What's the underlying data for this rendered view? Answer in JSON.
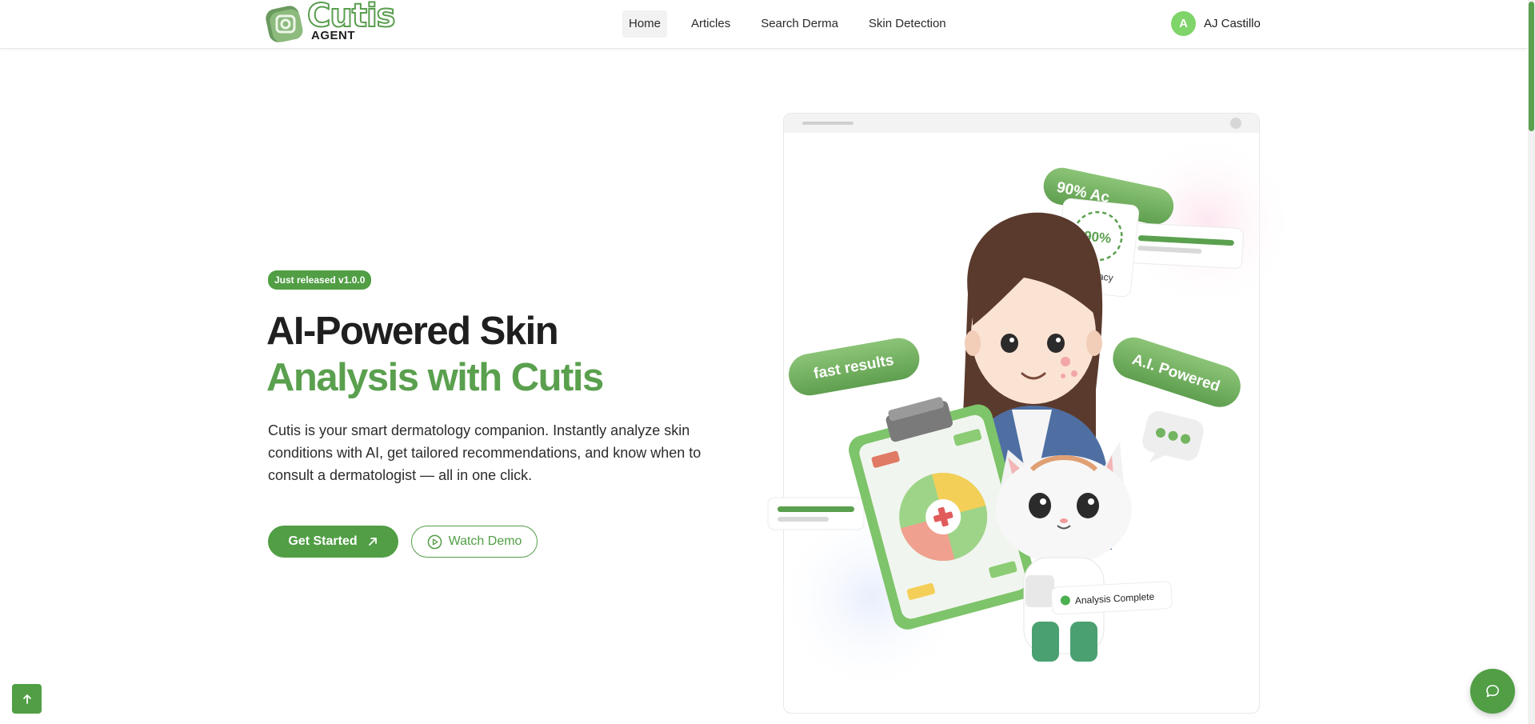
{
  "brand": {
    "name": "Cutis",
    "subtitle": "AGENT",
    "color": "#519e45"
  },
  "nav": {
    "items": [
      {
        "label": "Home",
        "active": true
      },
      {
        "label": "Articles",
        "active": false
      },
      {
        "label": "Search Derma",
        "active": false
      },
      {
        "label": "Skin Detection",
        "active": false
      }
    ]
  },
  "user": {
    "initial": "A",
    "name": "AJ Castillo"
  },
  "hero": {
    "badge": "Just released v1.0.0",
    "title_line1": "AI-Powered Skin",
    "title_line2": "Analysis with Cutis",
    "description": "Cutis is your smart dermatology companion. Instantly analyze skin conditions with AI, get tailored recommendations, and know when to consult a dermatologist — all in one click.",
    "primary_button": "Get Started",
    "secondary_button": "Watch Demo"
  },
  "illustration": {
    "accuracy_value": "90%",
    "accuracy_label": "Accuracy",
    "tag_accuracy": "90% Ac",
    "tag_fast": "fast results",
    "tag_ai": "A.I. Powered",
    "status_chip": "Analysis Complete"
  },
  "icons": {
    "get_started": "arrow-up-right-icon",
    "watch_demo": "play-circle-icon",
    "scroll_top": "arrow-up-icon",
    "chat": "chat-bubble-icon"
  }
}
